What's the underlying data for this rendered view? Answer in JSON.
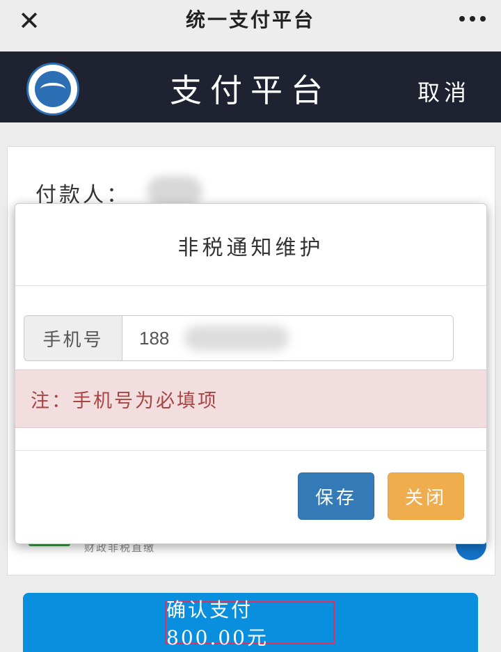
{
  "wechat_bar": {
    "title": "统一支付平台",
    "close_icon": "close-icon",
    "more_icon": "more-icon"
  },
  "header": {
    "title": "支付平台",
    "cancel_label": "取消",
    "logo_icon": "school-logo"
  },
  "background_form": {
    "payer_label": "付款人：",
    "subtitle": "财政非税直缴"
  },
  "modal": {
    "title": "非税通知维护",
    "phone_addon": "手机号",
    "phone_value": "188",
    "alert_text": "注：手机号为必填项",
    "save_label": "保存",
    "close_label": "关闭"
  },
  "confirm": {
    "label": "确认支付 800.00元"
  },
  "colors": {
    "header_bg": "#1f2230",
    "save_button": "#337ab7",
    "close_button": "#f0ad4e",
    "alert_bg": "#f2dede",
    "alert_text": "#a94442",
    "confirm_bg": "#0a8fdf",
    "highlight_border": "#e0305b"
  }
}
